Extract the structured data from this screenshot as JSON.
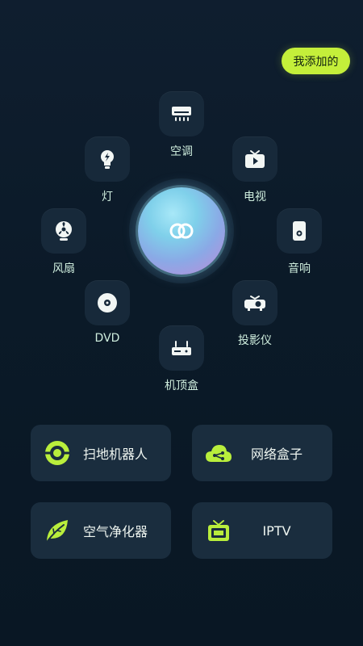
{
  "header": {
    "added_label": "我添加的"
  },
  "devices": [
    {
      "id": "ac",
      "label": "空调",
      "icon": "air-conditioner-icon"
    },
    {
      "id": "light",
      "label": "灯",
      "icon": "light-bulb-icon"
    },
    {
      "id": "tv",
      "label": "电视",
      "icon": "tv-icon"
    },
    {
      "id": "fan",
      "label": "风扇",
      "icon": "fan-icon"
    },
    {
      "id": "speaker",
      "label": "音响",
      "icon": "speaker-icon"
    },
    {
      "id": "dvd",
      "label": "DVD",
      "icon": "disc-icon"
    },
    {
      "id": "projector",
      "label": "投影仪",
      "icon": "projector-icon"
    },
    {
      "id": "settop",
      "label": "机顶盒",
      "icon": "set-top-box-icon"
    }
  ],
  "hub": {
    "icon": "link-rings-icon"
  },
  "cards": [
    {
      "label": "扫地机器人",
      "icon": "robot-vacuum-icon"
    },
    {
      "label": "网络盒子",
      "icon": "cloud-network-icon"
    },
    {
      "label": "空气净化器",
      "icon": "leaf-icon"
    },
    {
      "label": "IPTV",
      "icon": "iptv-icon"
    }
  ],
  "colors": {
    "accent": "#c4ef3a",
    "icon_green": "#b9ee3c",
    "background": "#0d1c2b",
    "tile": "#17293a"
  }
}
